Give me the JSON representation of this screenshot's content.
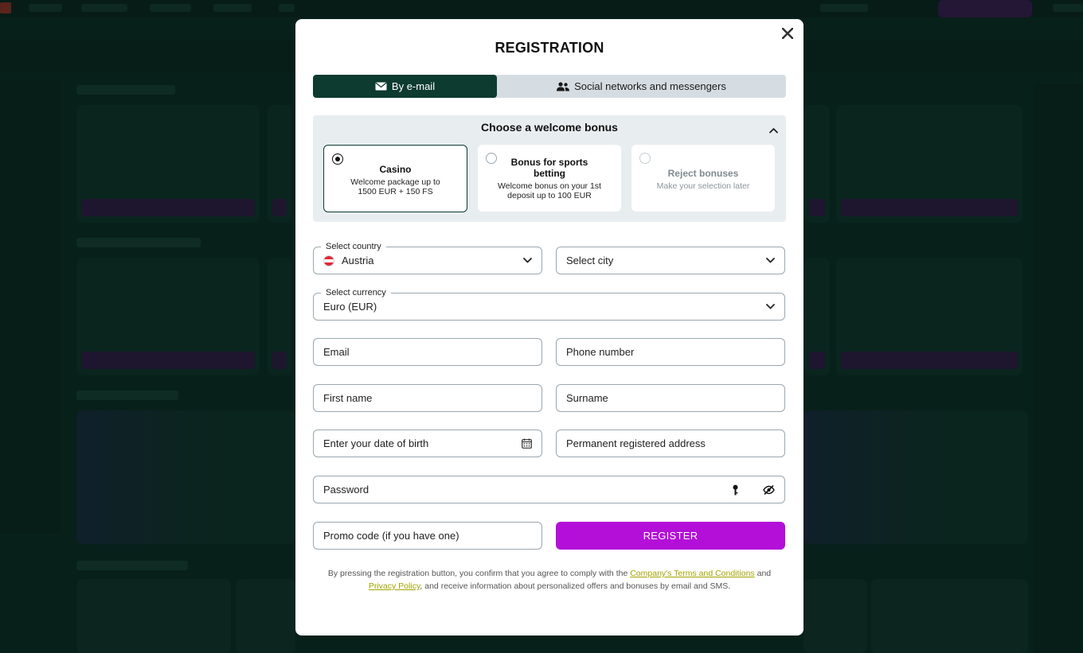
{
  "modal": {
    "title": "REGISTRATION",
    "close_icon": "close-icon"
  },
  "tabs": [
    {
      "label": "By e-mail",
      "icon": "envelope-icon",
      "active": true
    },
    {
      "label": "Social networks and messengers",
      "icon": "users-icon",
      "active": false
    }
  ],
  "bonus": {
    "title": "Choose a welcome bonus",
    "options": [
      {
        "name": "Casino",
        "desc": "Welcome package up to 1500 EUR + 150 FS",
        "selected": true
      },
      {
        "name": "Bonus for sports betting",
        "desc": "Welcome bonus on your 1st deposit up to 100 EUR",
        "selected": false
      },
      {
        "name": "Reject bonuses",
        "desc": "Make your selection later",
        "selected": false
      }
    ]
  },
  "form": {
    "country": {
      "label": "Select country",
      "value": "Austria"
    },
    "city": {
      "placeholder": "Select city"
    },
    "currency": {
      "label": "Select currency",
      "value": "Euro (EUR)"
    },
    "email": {
      "placeholder": "Email"
    },
    "phone": {
      "placeholder": "Phone number"
    },
    "first_name": {
      "placeholder": "First name"
    },
    "surname": {
      "placeholder": "Surname"
    },
    "dob": {
      "placeholder": "Enter your date of birth"
    },
    "address": {
      "placeholder": "Permanent registered address"
    },
    "password": {
      "placeholder": "Password"
    },
    "promo": {
      "placeholder": "Promo code (if you have one)"
    },
    "register_label": "REGISTER"
  },
  "legal": {
    "text_1": "By pressing the registration button, you confirm that you agree to comply with the",
    "terms_link": "Company's Terms and Conditions",
    "text_2": "and",
    "privacy_link": "Privacy Policy",
    "text_3": ", and receive information about personalized offers and bonuses by email and SMS."
  },
  "colors": {
    "accent": "#b30fd8",
    "dark_green": "#0d3b30",
    "link": "#a3a300"
  }
}
